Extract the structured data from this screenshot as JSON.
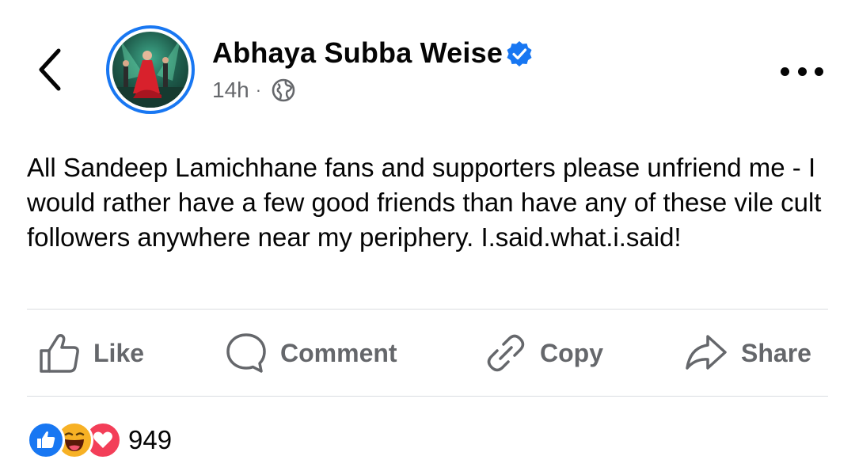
{
  "post": {
    "author": "Abhaya Subba Weise",
    "time": "14h",
    "separator": "·",
    "privacy_icon": "globe-icon",
    "verified_icon": "verified-badge-icon",
    "text": "All Sandeep Lamichhane fans and supporters please unfriend me - I would rather have a few good friends than have any of these vile cult followers anywhere near my periphery. I.said.what.i.said!"
  },
  "actions": {
    "like": "Like",
    "comment": "Comment",
    "copy": "Copy",
    "share": "Share"
  },
  "reactions": {
    "icons": [
      "like-reaction-icon",
      "haha-reaction-icon",
      "love-reaction-icon"
    ],
    "count": "949"
  },
  "colors": {
    "brand_blue": "#1877f2",
    "secondary_text": "#65676b",
    "love_red": "#f33e58",
    "haha_yellow": "#f7b125"
  }
}
